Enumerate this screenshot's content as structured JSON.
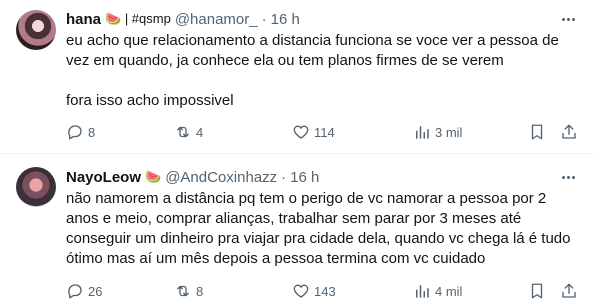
{
  "tweets": [
    {
      "name": "hana",
      "badge": "🍉 | #qsmp",
      "handle": "@hanamor_",
      "dot": "·",
      "time": "16 h",
      "paragraphs": [
        "eu acho que relacionamento a distancia funciona se voce ver a pessoa de vez em quando, ja conhece ela ou tem planos firmes de se verem",
        "fora isso acho impossivel"
      ],
      "replies": "8",
      "retweets": "4",
      "likes": "114",
      "views": "3 mil"
    },
    {
      "name": "NayoLeow",
      "badge": "🍉",
      "handle": "@AndCoxinhazz",
      "dot": "·",
      "time": "16 h",
      "paragraphs": [
        "não namorem a distância pq tem o perigo de vc namorar a pessoa por 2 anos e meio, comprar alianças, trabalhar sem parar por 3 meses até conseguir um dinheiro pra viajar pra cidade dela, quando vc chega lá é tudo ótimo mas aí um mês depois a pessoa termina com vc cuidado"
      ],
      "replies": "26",
      "retweets": "8",
      "likes": "143",
      "views": "4 mil"
    }
  ],
  "icons": {
    "reply": "reply-icon",
    "retweet": "retweet-icon",
    "like": "heart-icon",
    "views": "views-icon",
    "bookmark": "bookmark-icon",
    "share": "share-icon",
    "more": "more-icon"
  },
  "colors": {
    "text": "#0f1419",
    "secondary": "#536471",
    "divider": "#eff3f4"
  }
}
